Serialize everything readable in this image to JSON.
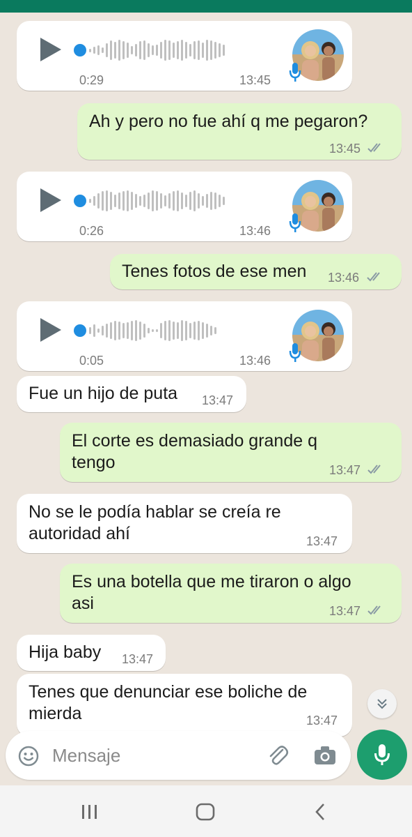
{
  "messages": [
    {
      "type": "voice",
      "duration": "0:29",
      "time": "13:45"
    },
    {
      "type": "text",
      "text": "Ah y pero no fue ahí q me pegaron?",
      "time": "13:45"
    },
    {
      "type": "voice",
      "duration": "0:26",
      "time": "13:46"
    },
    {
      "type": "text",
      "text": "Tenes fotos de ese men",
      "time": "13:46"
    },
    {
      "type": "voice",
      "duration": "0:05",
      "time": "13:46"
    },
    {
      "type": "text",
      "text": "Fue un hijo de puta",
      "time": "13:47"
    },
    {
      "type": "text",
      "line1": "El corte es demasiado grande q",
      "line2": "tengo",
      "time": "13:47"
    },
    {
      "type": "text",
      "line1": "No se le podía hablar se creía re",
      "line2": "autoridad ahí",
      "time": "13:47"
    },
    {
      "type": "text",
      "line1": "Es una botella que me tiraron o algo",
      "line2": "asi",
      "time": "13:47"
    },
    {
      "type": "text",
      "text": "Hija baby",
      "time": "13:47"
    },
    {
      "type": "text",
      "line1": "Tenes que denunciar ese boliche de",
      "line2": "mierda",
      "time": "13:47"
    }
  ],
  "composer": {
    "placeholder": "Mensaje",
    "icons": {
      "emoji": "emoji-icon",
      "attach": "paperclip-icon",
      "camera": "camera-icon",
      "mic": "microphone-icon"
    }
  },
  "colors": {
    "incoming": "#ffffff",
    "outgoing": "#e1f7cb",
    "accent": "#1d9e6e",
    "topbar": "#0a7a5e",
    "read_ticks": "#8a9aa4"
  },
  "navbar": {
    "icons": [
      "recent-apps-icon",
      "home-icon",
      "back-icon"
    ]
  }
}
